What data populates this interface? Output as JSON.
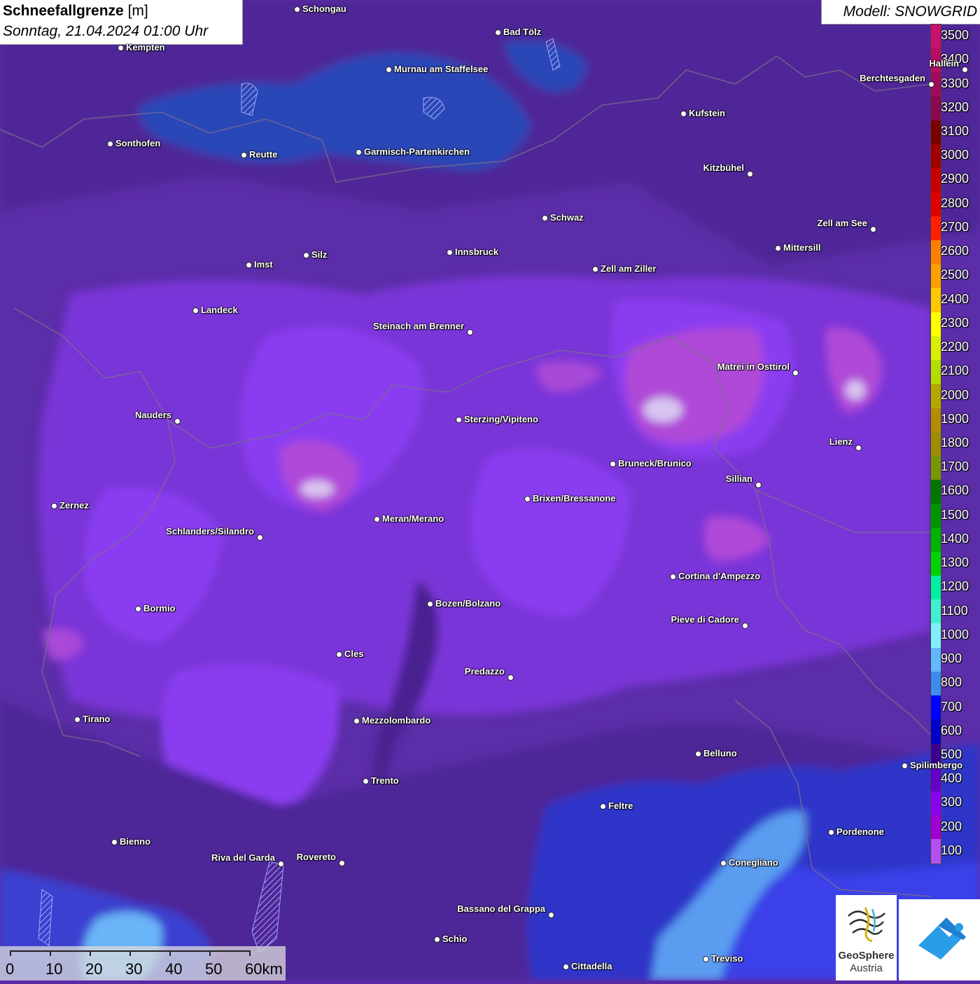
{
  "header": {
    "title": "Schneefallgrenze",
    "unit": "[m]",
    "datetime": "Sonntag, 21.04.2024 01:00 Uhr",
    "model": "Modell: SNOWGRID"
  },
  "legend": {
    "levels": [
      "3500",
      "3400",
      "3300",
      "3200",
      "3100",
      "3000",
      "2900",
      "2800",
      "2700",
      "2600",
      "2500",
      "2400",
      "2300",
      "2200",
      "2100",
      "2000",
      "1900",
      "1800",
      "1700",
      "1600",
      "1500",
      "1400",
      "1300",
      "1200",
      "1100",
      "1000",
      "900",
      "800",
      "700",
      "600",
      "500",
      "400",
      "300",
      "200",
      "100"
    ],
    "colors": [
      "#c8106e",
      "#b80c64",
      "#a00a5c",
      "#8a0850",
      "#7a0000",
      "#a00000",
      "#c80000",
      "#e00000",
      "#ff2000",
      "#ff8000",
      "#ffa000",
      "#ffc800",
      "#ffff00",
      "#d8f000",
      "#b4dc00",
      "#b4a800",
      "#b48c00",
      "#a08c00",
      "#789600",
      "#007800",
      "#009600",
      "#00b400",
      "#00d200",
      "#00f0a0",
      "#40f0d0",
      "#80f0ff",
      "#60b8ff",
      "#3c8cf0",
      "#0000ff",
      "#0000c8",
      "#3c0090",
      "#6400c8",
      "#8c00f0",
      "#a000d2",
      "#b450f0"
    ]
  },
  "cities": [
    {
      "name": "Schongau"
    },
    {
      "name": "Bad Tölz"
    },
    {
      "name": "Kempten"
    },
    {
      "name": "Murnau am Staffelsee"
    },
    {
      "name": "Kufstein"
    },
    {
      "name": "Berchtesgaden"
    },
    {
      "name": "Sonthofen"
    },
    {
      "name": "Reutte"
    },
    {
      "name": "Garmisch-Partenkirchen"
    },
    {
      "name": "Kitzbühel"
    },
    {
      "name": "Schwaz"
    },
    {
      "name": "Zell am See"
    },
    {
      "name": "Innsbruck"
    },
    {
      "name": "Mittersill"
    },
    {
      "name": "Imst"
    },
    {
      "name": "Silz"
    },
    {
      "name": "Zell am Ziller"
    },
    {
      "name": "Landeck"
    },
    {
      "name": "Steinach am Brenner"
    },
    {
      "name": "Matrei in Osttirol"
    },
    {
      "name": "Nauders"
    },
    {
      "name": "Sterzing/Vipiteno"
    },
    {
      "name": "Lienz"
    },
    {
      "name": "Bruneck/Brunico"
    },
    {
      "name": "Sillian"
    },
    {
      "name": "Zernez"
    },
    {
      "name": "Brixen/Bressanone"
    },
    {
      "name": "Meran/Merano"
    },
    {
      "name": "Schlanders/Silandro"
    },
    {
      "name": "Cortina d'Ampezzo"
    },
    {
      "name": "Bormio"
    },
    {
      "name": "Bozen/Bolzano"
    },
    {
      "name": "Pieve di Cadore"
    },
    {
      "name": "Cles"
    },
    {
      "name": "Predazzo"
    },
    {
      "name": "Tirano"
    },
    {
      "name": "Mezzolombardo"
    },
    {
      "name": "Belluno"
    },
    {
      "name": "Spilimbergo"
    },
    {
      "name": "Trento"
    },
    {
      "name": "Feltre"
    },
    {
      "name": "Pordenone"
    },
    {
      "name": "Bienno"
    },
    {
      "name": "Riva del Garda"
    },
    {
      "name": "Rovereto"
    },
    {
      "name": "Conegliano"
    },
    {
      "name": "Bassano del Grappa"
    },
    {
      "name": "Schio"
    },
    {
      "name": "Treviso"
    },
    {
      "name": "Cittadella"
    },
    {
      "name": "Hallein"
    }
  ],
  "scale": {
    "labels": [
      "0",
      "10",
      "20",
      "30",
      "40",
      "50",
      "60km"
    ]
  },
  "logos": {
    "geosphere_line1": "GeoSphere",
    "geosphere_line2": "Austria"
  }
}
